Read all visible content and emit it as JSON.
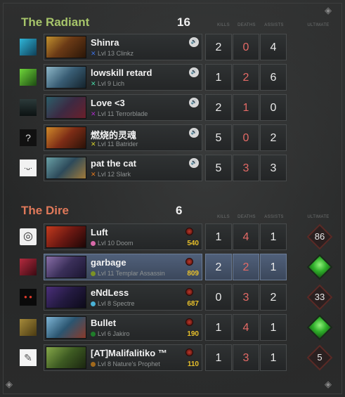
{
  "radiant": {
    "title": "The Radiant",
    "score": "16",
    "color": "#a7c56a",
    "players": [
      {
        "name": "Shinra",
        "mark": "✕",
        "mark_color": "#3b6fe0",
        "hero": "Lvl 13 Clinkz",
        "k": "2",
        "d": "0",
        "a": "4",
        "avatar": "icon-avatar-blue"
      },
      {
        "name": "lowskill retard",
        "mark": "✕",
        "mark_color": "#48d7a6",
        "hero": "Lvl 9 Lich",
        "k": "1",
        "d": "2",
        "a": "6",
        "avatar": "icon-avatar-green"
      },
      {
        "name": "Love <3",
        "mark": "✕",
        "mark_color": "#a92bc4",
        "hero": "Lvl 11 Terrorblade",
        "k": "2",
        "d": "1",
        "a": "0",
        "avatar": "icon-avatar-figure"
      },
      {
        "name": "燃烧的灵魂",
        "mark": "✕",
        "mark_color": "#d5d02c",
        "hero": "Lvl 11 Batrider",
        "k": "5",
        "d": "0",
        "a": "2",
        "avatar": "?"
      },
      {
        "name": "pat the cat",
        "mark": "✕",
        "mark_color": "#e0781d",
        "hero": "Lvl 12 Slark",
        "k": "5",
        "d": "3",
        "a": "3",
        "avatar": "icon-avatar-face"
      }
    ]
  },
  "dire": {
    "title": "The Dire",
    "score": "6",
    "color": "#e0795a",
    "players": [
      {
        "name": "Luft",
        "dot_color": "#d76aa9",
        "hero": "Lvl 10 Doom",
        "gold": "540",
        "k": "1",
        "d": "4",
        "a": "1",
        "ult": "86",
        "ult_state": "cooldown"
      },
      {
        "name": "garbage",
        "dot_color": "#7c9225",
        "hero": "Lvl 11 Templar Assassin",
        "gold": "809",
        "k": "2",
        "d": "2",
        "a": "1",
        "ult": "",
        "ult_state": "ready",
        "highlight": true
      },
      {
        "name": "eNdLess",
        "dot_color": "#4ab1d6",
        "hero": "Lvl 8 Spectre",
        "gold": "687",
        "k": "0",
        "d": "3",
        "a": "2",
        "ult": "33",
        "ult_state": "cooldown"
      },
      {
        "name": "Bullet",
        "dot_color": "#1f7d2a",
        "hero": "Lvl 6 Jakiro",
        "gold": "190",
        "k": "1",
        "d": "4",
        "a": "1",
        "ult": "",
        "ult_state": "ready"
      },
      {
        "name": "[AT]Malifalitiko ™",
        "dot_color": "#a1681c",
        "hero": "Lvl 8 Nature's Prophet",
        "gold": "110",
        "k": "1",
        "d": "3",
        "a": "1",
        "ult": "5",
        "ult_state": "cooldown"
      }
    ]
  },
  "columns": {
    "kills": "KILLS",
    "deaths": "DEATHS",
    "assists": "ASSISTS",
    "ultimate": "ULTIMATE"
  }
}
